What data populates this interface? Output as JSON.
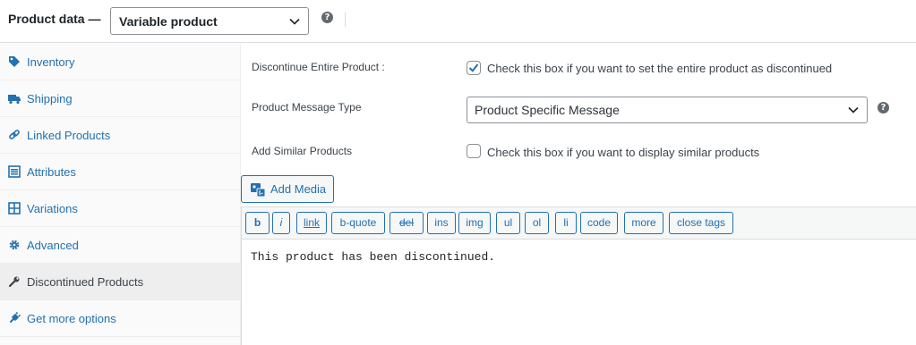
{
  "header": {
    "title": "Product data —",
    "product_type": "Variable product",
    "help_glyph": "?"
  },
  "sidebar": {
    "items": [
      {
        "label": "Inventory",
        "icon": "tag-icon"
      },
      {
        "label": "Shipping",
        "icon": "truck-icon"
      },
      {
        "label": "Linked Products",
        "icon": "link-icon"
      },
      {
        "label": "Attributes",
        "icon": "list-icon"
      },
      {
        "label": "Variations",
        "icon": "grid-icon"
      },
      {
        "label": "Advanced",
        "icon": "gear-icon"
      },
      {
        "label": "Discontinued Products",
        "icon": "wrench-icon",
        "active": true
      },
      {
        "label": "Get more options",
        "icon": "plug-icon"
      }
    ]
  },
  "form": {
    "discontinue_label": "Discontinue Entire Product :",
    "discontinue_checked": true,
    "discontinue_text": "Check this box if you want to set the entire product as discontinued",
    "message_type_label": "Product Message Type",
    "message_type_value": "Product Specific Message",
    "similar_label": "Add Similar Products",
    "similar_checked": false,
    "similar_text": "Check this box if you want to display similar products"
  },
  "editor": {
    "add_media": "Add Media",
    "buttons": [
      "b",
      "i",
      "link",
      "b-quote",
      "del",
      "ins",
      "img",
      "ul",
      "ol",
      "li",
      "code",
      "more",
      "close tags"
    ],
    "content": "This product has been discontinued."
  },
  "colors": {
    "link": "#2271b1",
    "text": "#3c434a",
    "border": "#8c8f94"
  }
}
